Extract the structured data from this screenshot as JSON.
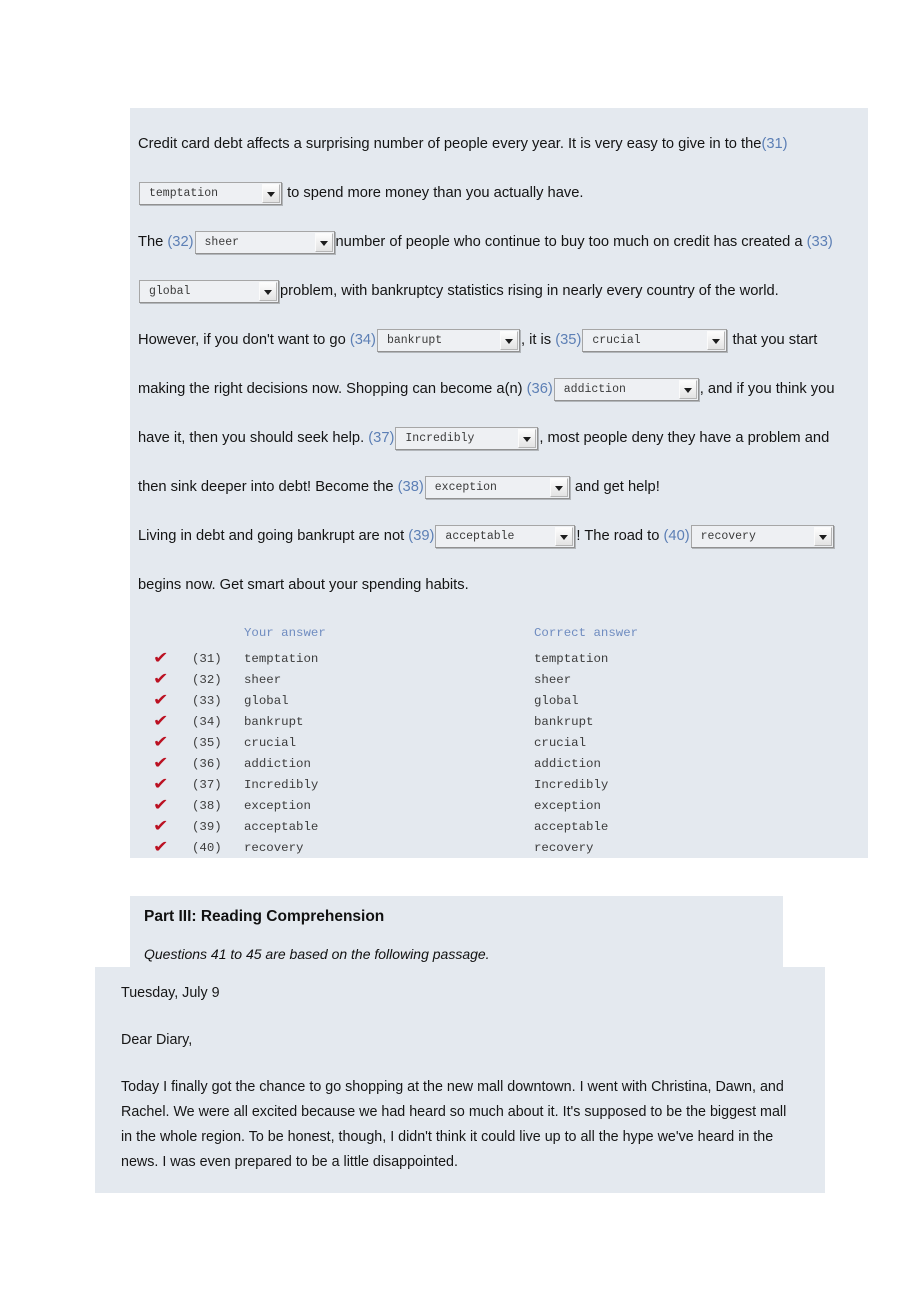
{
  "cloze": {
    "segments": [
      {
        "type": "text",
        "value": "Credit card debt affects a surprising number of people every year. It is very easy to give in to the"
      },
      {
        "type": "num",
        "value": "(31)"
      },
      {
        "type": "select",
        "value": "temptation"
      },
      {
        "type": "text",
        "value": " to spend more money than you actually have."
      },
      {
        "type": "text",
        "value": "The "
      },
      {
        "type": "num",
        "value": "(32)"
      },
      {
        "type": "select",
        "value": "sheer"
      },
      {
        "type": "text",
        "value": "number of people who continue to buy too much on credit has created a "
      },
      {
        "type": "num",
        "value": "(33)"
      },
      {
        "type": "select",
        "value": "global"
      },
      {
        "type": "text",
        "value": "problem, with bankruptcy statistics rising in nearly every country of the world."
      },
      {
        "type": "text",
        "value": "However, if you don't want to go "
      },
      {
        "type": "num",
        "value": "(34)"
      },
      {
        "type": "select",
        "value": "bankrupt"
      },
      {
        "type": "text",
        "value": ", it is "
      },
      {
        "type": "num",
        "value": "(35)"
      },
      {
        "type": "select",
        "value": "crucial"
      },
      {
        "type": "text",
        "value": " that you start making the right decisions now. Shopping can become a(n) "
      },
      {
        "type": "num",
        "value": "(36)"
      },
      {
        "type": "select",
        "value": "addiction"
      },
      {
        "type": "text",
        "value": ", and if you think you have it, then you should seek help. "
      },
      {
        "type": "num",
        "value": "(37)"
      },
      {
        "type": "select",
        "value": "Incredibly"
      },
      {
        "type": "text",
        "value": ", most people deny they have a problem and then sink deeper into debt! Become the "
      },
      {
        "type": "num",
        "value": "(38)"
      },
      {
        "type": "select",
        "value": "exception"
      },
      {
        "type": "text",
        "value": " and get help!"
      },
      {
        "type": "text",
        "value": "Living in debt and going bankrupt are not "
      },
      {
        "type": "num",
        "value": "(39)"
      },
      {
        "type": "select",
        "value": "acceptable"
      },
      {
        "type": "text",
        "value": "! The road to "
      },
      {
        "type": "num",
        "value": "(40)"
      },
      {
        "type": "select",
        "value": "recovery"
      },
      {
        "type": "text",
        "value": "begins now. Get smart about your spending habits."
      }
    ],
    "p1": {
      "lead": "Credit card debt affects a surprising number of people every year. It is very easy to give in to the",
      "num31": "(31)",
      "sel31": "temptation",
      "tail": " to spend more money than you actually have."
    },
    "p2": {
      "lead": "The ",
      "num32": "(32)",
      "sel32": "sheer",
      "mid": "number of people who continue to buy too much on credit has created a ",
      "num33": "(33)",
      "sel33": "global",
      "tail": "problem, with bankruptcy statistics rising in nearly every country of the world."
    },
    "p3": {
      "lead": "However, if you don't want to go ",
      "num34": "(34)",
      "sel34": "bankrupt",
      "mid1": ", it is ",
      "num35": "(35)",
      "sel35": "crucial",
      "mid2": " that you start making the right decisions now. Shopping can become a(n) ",
      "num36": "(36)",
      "sel36": "addiction",
      "mid3": ", and if you think you have it, then you should seek help. ",
      "num37": "(37)",
      "sel37": "Incredibly",
      "mid4": ", most people deny they have a problem and then sink deeper into debt! Become the ",
      "num38": "(38)",
      "sel38": "exception",
      "tail": " and get help!"
    },
    "p4": {
      "lead": "Living in debt and going bankrupt are not ",
      "num39": "(39)",
      "sel39": "acceptable",
      "mid": "! The road to ",
      "num40": "(40)",
      "sel40": "recovery",
      "tail": "begins now. Get smart about your spending habits."
    }
  },
  "answer_table": {
    "headers": {
      "mark": "",
      "number": "",
      "your_answer": "Your answer",
      "correct_answer": "Correct answer"
    },
    "mark_glyph": "✔",
    "mark_color": "#bb1122",
    "rows": [
      {
        "mark": "✔",
        "number": "(31)",
        "your": "temptation",
        "correct": "temptation"
      },
      {
        "mark": "✔",
        "number": "(32)",
        "your": "sheer",
        "correct": "sheer"
      },
      {
        "mark": "✔",
        "number": "(33)",
        "your": "global",
        "correct": "global"
      },
      {
        "mark": "✔",
        "number": "(34)",
        "your": "bankrupt",
        "correct": "bankrupt"
      },
      {
        "mark": "✔",
        "number": "(35)",
        "your": "crucial",
        "correct": "crucial"
      },
      {
        "mark": "✔",
        "number": "(36)",
        "your": "addiction",
        "correct": "addiction"
      },
      {
        "mark": "✔",
        "number": "(37)",
        "your": "Incredibly",
        "correct": "Incredibly"
      },
      {
        "mark": "✔",
        "number": "(38)",
        "your": "exception",
        "correct": "exception"
      },
      {
        "mark": "✔",
        "number": "(39)",
        "your": "acceptable",
        "correct": "acceptable"
      },
      {
        "mark": "✔",
        "number": "(40)",
        "your": "recovery",
        "correct": "recovery"
      }
    ]
  },
  "part3": {
    "title": "Part III: Reading Comprehension",
    "subtitle": "Questions 41 to 45 are based on the following passage."
  },
  "diary": {
    "date": "Tuesday, July 9",
    "salutation": "Dear Diary,",
    "body": "Today I finally got the chance to go shopping at the new mall downtown. I went with Christina, Dawn, and Rachel. We were all excited because we had heard so much about it. It's supposed to be the biggest mall in the whole region. To be honest, though, I didn't think it could live up to all the hype we've heard in the news. I was even prepared to be a little disappointed."
  },
  "colors": {
    "panel_bg": "#e4e9ef",
    "question_number": "#5c7fb5",
    "table_header": "#6f8cc0",
    "check_mark": "#bb1122",
    "page_bg": "#ffffff"
  }
}
